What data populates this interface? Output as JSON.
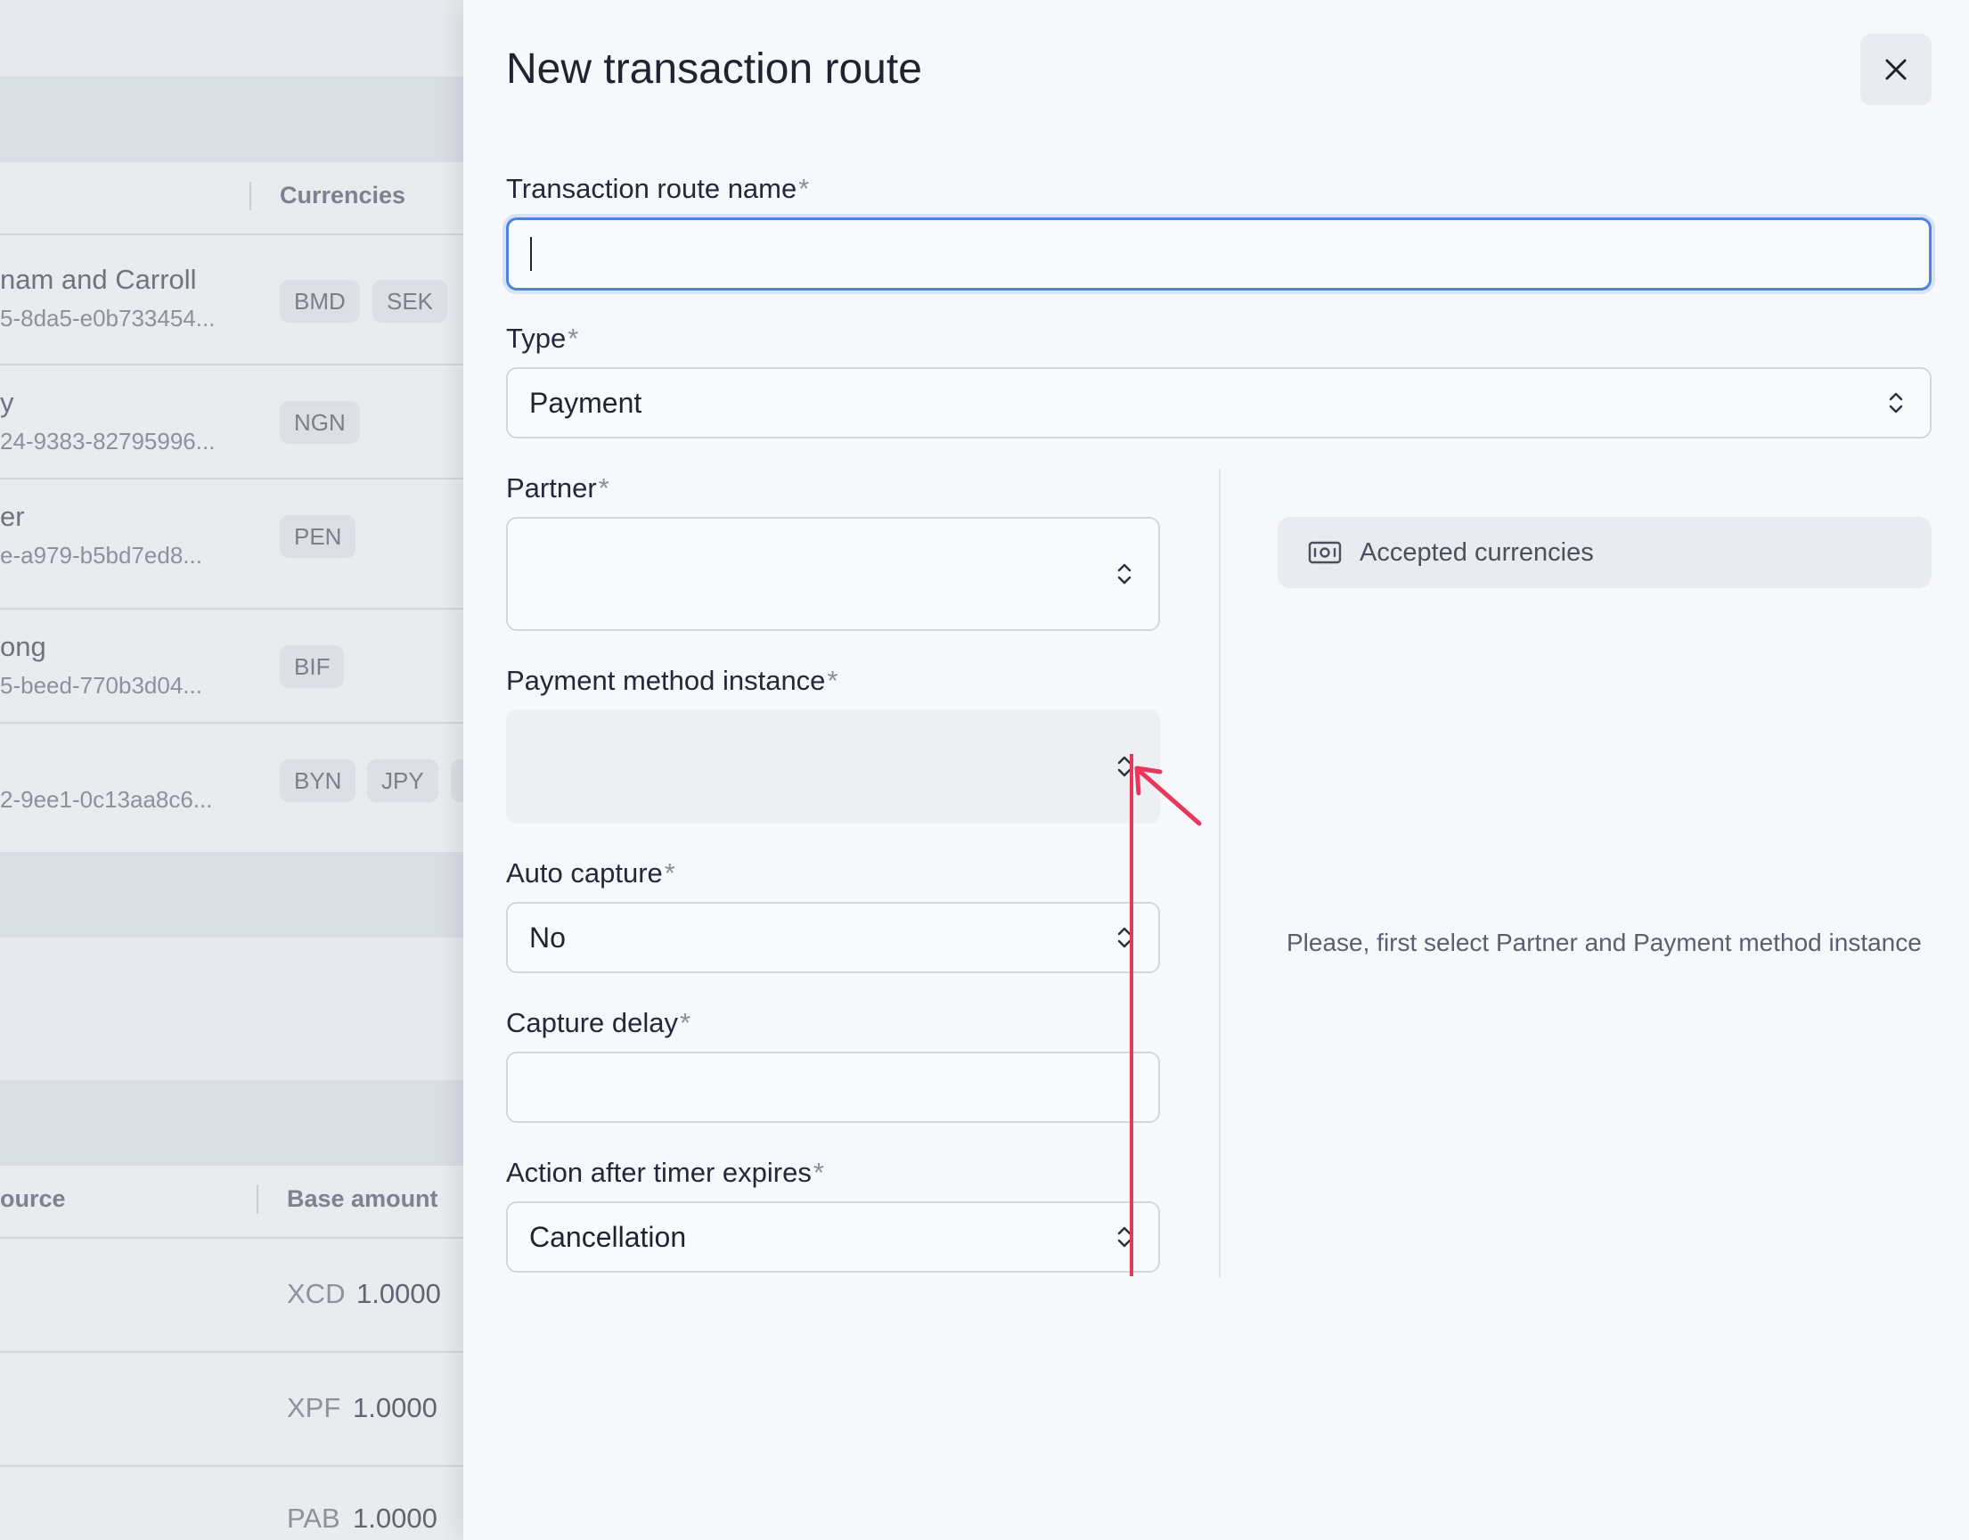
{
  "background": {
    "table1": {
      "header_currencies": "Currencies",
      "rows": [
        {
          "name": "nam and Carroll",
          "id": "5-8da5-e0b733454...",
          "currencies": [
            "BMD",
            "SEK"
          ]
        },
        {
          "name": "y",
          "id": "24-9383-82795996...",
          "currencies": [
            "NGN"
          ]
        },
        {
          "name": "er",
          "id": "e-a979-b5bd7ed8...",
          "currencies": [
            "PEN"
          ]
        },
        {
          "name": "ong",
          "id": "5-beed-770b3d04...",
          "currencies": [
            "BIF"
          ]
        },
        {
          "name": "",
          "id": "2-9ee1-0c13aa8c6...",
          "currencies": [
            "BYN",
            "JPY"
          ]
        }
      ]
    },
    "table2": {
      "header_source": "ource",
      "header_base_amount": "Base amount",
      "rows": [
        {
          "currency": "XCD",
          "amount": "1.0000"
        },
        {
          "currency": "XPF",
          "amount": "1.0000"
        },
        {
          "currency": "PAB",
          "amount": "1.0000"
        }
      ]
    }
  },
  "drawer": {
    "title": "New transaction route",
    "close_icon": "close-icon",
    "fields": {
      "route_name": {
        "label": "Transaction route name",
        "required": "*",
        "value": ""
      },
      "type": {
        "label": "Type",
        "required": "*",
        "value": "Payment"
      },
      "partner": {
        "label": "Partner",
        "required": "*",
        "value": ""
      },
      "payment_method_instance": {
        "label": "Payment method instance",
        "required": "*",
        "value": ""
      },
      "auto_capture": {
        "label": "Auto capture",
        "required": "*",
        "value": "No"
      },
      "capture_delay": {
        "label": "Capture delay",
        "required": "*",
        "value": ""
      },
      "action_after_timer": {
        "label": "Action after timer expires",
        "required": "*",
        "value": "Cancellation"
      }
    },
    "accepted_currencies": {
      "label": "Accepted currencies",
      "icon": "banknote-icon"
    },
    "hint": "Please, first select Partner and Payment method instance"
  },
  "colors": {
    "accent_focus": "#4d82e0",
    "annotation": "#e8365d"
  }
}
